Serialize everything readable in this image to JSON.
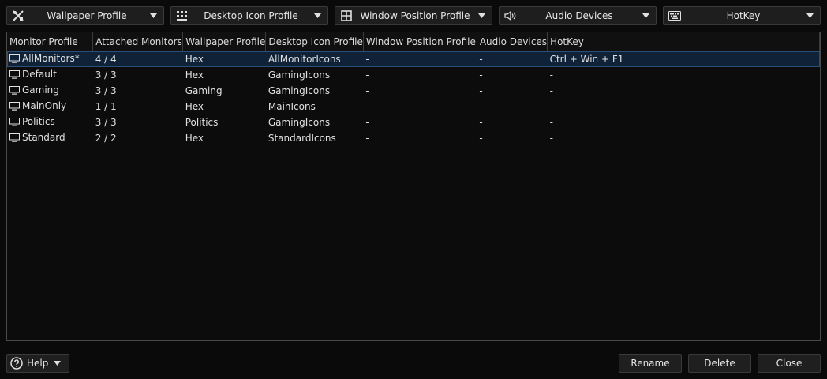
{
  "toolbar": {
    "dropdowns": [
      {
        "label": "Wallpaper Profile",
        "icon": "wallpaper-icon"
      },
      {
        "label": "Desktop Icon Profile",
        "icon": "desktop-icons-icon"
      },
      {
        "label": "Window Position Profile",
        "icon": "window-grid-icon"
      },
      {
        "label": "Audio Devices",
        "icon": "speaker-icon"
      },
      {
        "label": "HotKey",
        "icon": "keyboard-icon"
      }
    ]
  },
  "table": {
    "columns": [
      "Monitor Profile",
      "Attached Monitors",
      "Wallpaper Profile",
      "Desktop Icon Profile",
      "Window Position Profile",
      "Audio Devices",
      "HotKey"
    ],
    "rows": [
      {
        "cells": [
          "AllMonitors*",
          "4 / 4",
          "Hex",
          "AllMonitorIcons",
          "-",
          "-",
          "Ctrl + Win + F1"
        ],
        "selected": true
      },
      {
        "cells": [
          "Default",
          "3 / 3",
          "Hex",
          "GamingIcons",
          "-",
          "-",
          "-"
        ],
        "selected": false
      },
      {
        "cells": [
          "Gaming",
          "3 / 3",
          "Gaming",
          "GamingIcons",
          "-",
          "-",
          "-"
        ],
        "selected": false
      },
      {
        "cells": [
          "MainOnly",
          "1 / 1",
          "Hex",
          "MainIcons",
          "-",
          "-",
          "-"
        ],
        "selected": false
      },
      {
        "cells": [
          "Politics",
          "3 / 3",
          "Politics",
          "GamingIcons",
          "-",
          "-",
          "-"
        ],
        "selected": false
      },
      {
        "cells": [
          "Standard",
          "2 / 2",
          "Hex",
          "StandardIcons",
          "-",
          "-",
          "-"
        ],
        "selected": false
      }
    ]
  },
  "footer": {
    "help_label": "Help",
    "rename_label": "Rename",
    "delete_label": "Delete",
    "close_label": "Close"
  },
  "colors": {
    "selection": "#0f2238",
    "background": "#0a0a0a",
    "border": "#3a3a3a"
  }
}
